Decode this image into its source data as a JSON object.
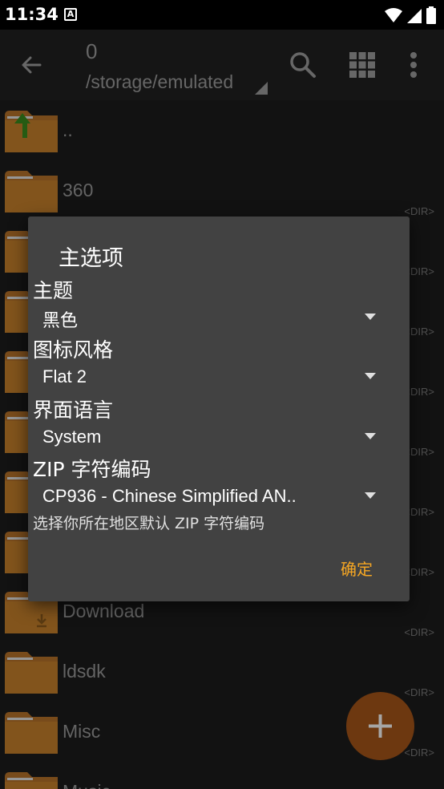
{
  "status_bar": {
    "time": "11:34",
    "notification_icon": "A"
  },
  "app_bar": {
    "count": "0",
    "path": "/storage/emulated"
  },
  "files": [
    {
      "name": "..",
      "dir": ""
    },
    {
      "name": "360",
      "dir": "<DIR>"
    },
    {
      "name": "",
      "dir": "<DIR>"
    },
    {
      "name": "",
      "dir": "<DIR>"
    },
    {
      "name": "",
      "dir": "<DIR>"
    },
    {
      "name": "",
      "dir": "<DIR>"
    },
    {
      "name": "",
      "dir": "<DIR>"
    },
    {
      "name": "",
      "dir": "<DIR>"
    },
    {
      "name": "Download",
      "dir": "<DIR>"
    },
    {
      "name": "ldsdk",
      "dir": "<DIR>"
    },
    {
      "name": "Misc",
      "dir": "<DIR>"
    },
    {
      "name": "Music",
      "dir": ""
    }
  ],
  "dialog": {
    "title": "主选项",
    "theme_label": "主题",
    "theme_value": "黑色",
    "icon_style_label": "图标风格",
    "icon_style_value": "Flat 2",
    "language_label": "界面语言",
    "language_value": "System",
    "zip_label": "ZIP 字符编码",
    "zip_value": "CP936 - Chinese Simplified AN..",
    "zip_hint": "选择你所在地区默认 ZIP 字符编码",
    "ok_label": "确定"
  },
  "colors": {
    "accent": "#f5a623",
    "folder": "#c8822b",
    "fab": "#a8561a",
    "dialog_bg": "#424242"
  },
  "icons": {
    "back": "back-arrow-icon",
    "search": "search-icon",
    "grid": "grid-view-icon",
    "more": "more-vert-icon",
    "fab": "plus-icon"
  }
}
